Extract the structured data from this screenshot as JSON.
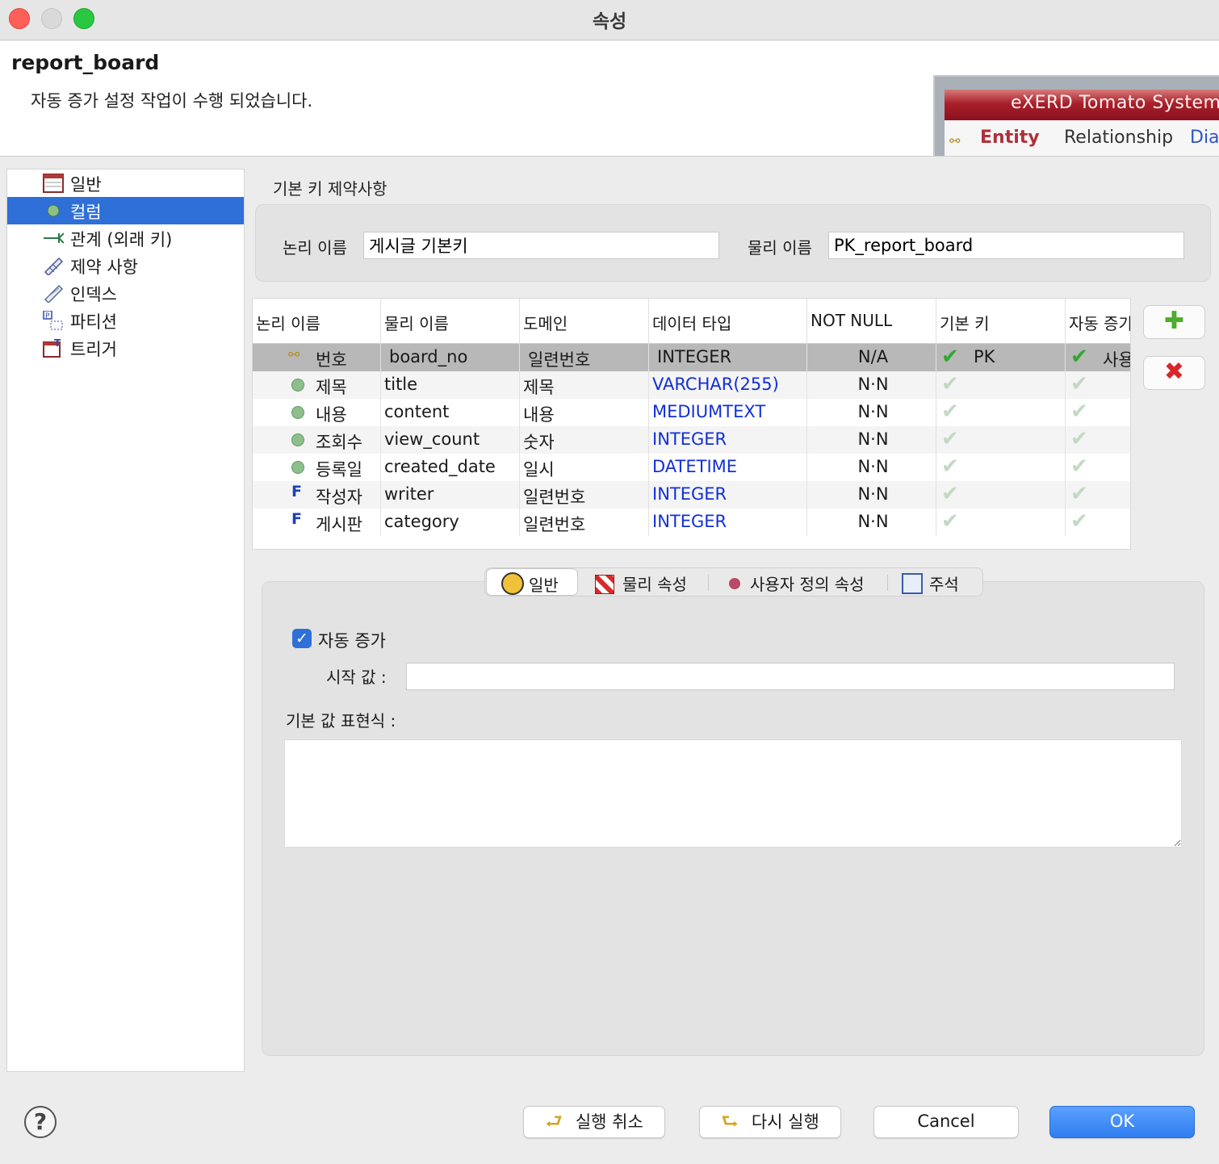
{
  "window": {
    "title": "속성"
  },
  "header": {
    "entity_name": "report_board",
    "message": "자동 증가 설정 작업이 수행 되었습니다.",
    "banner": {
      "app_title": "eXERD  Tomato System",
      "menu": [
        "Entity",
        "Relationship",
        "Dia"
      ]
    }
  },
  "sidebar": {
    "items": [
      {
        "label": "일반",
        "icon": "table-icon"
      },
      {
        "label": "컬럼",
        "icon": "column-icon"
      },
      {
        "label": "관계 (외래 키)",
        "icon": "relationship-icon"
      },
      {
        "label": "제약 사항",
        "icon": "constraint-icon"
      },
      {
        "label": "인덱스",
        "icon": "index-icon"
      },
      {
        "label": "파티션",
        "icon": "partition-icon"
      },
      {
        "label": "트리거",
        "icon": "trigger-icon"
      }
    ],
    "selected": "컬럼"
  },
  "pk": {
    "section_title": "기본 키 제약사항",
    "logical_label": "논리 이름",
    "logical_value": "게시글 기본키",
    "physical_label": "물리 이름",
    "physical_value": "PK_report_board"
  },
  "grid": {
    "headers": [
      "논리 이름",
      "물리 이름",
      "도메인",
      "데이터 타입",
      "NOT NULL",
      "기본 키",
      "자동 증가"
    ],
    "rows": [
      {
        "logical": "번호",
        "physical": "board_no",
        "domain": "일련번호",
        "type": "INTEGER",
        "notnull": "N/A",
        "pk": "PK",
        "auto": "사용",
        "kind": "key"
      },
      {
        "logical": "제목",
        "physical": "title",
        "domain": "제목",
        "type": "VARCHAR(255)",
        "notnull": "N·N",
        "pk": "",
        "auto": "",
        "kind": "attr"
      },
      {
        "logical": "내용",
        "physical": "content",
        "domain": "내용",
        "type": "MEDIUMTEXT",
        "notnull": "N·N",
        "pk": "",
        "auto": "",
        "kind": "attr"
      },
      {
        "logical": "조회수",
        "physical": "view_count",
        "domain": "숫자",
        "type": "INTEGER",
        "notnull": "N·N",
        "pk": "",
        "auto": "",
        "kind": "attr"
      },
      {
        "logical": "등록일",
        "physical": "created_date",
        "domain": "일시",
        "type": "DATETIME",
        "notnull": "N·N",
        "pk": "",
        "auto": "",
        "kind": "attr"
      },
      {
        "logical": "작성자",
        "physical": "writer",
        "domain": "일련번호",
        "type": "INTEGER",
        "notnull": "N·N",
        "pk": "",
        "auto": "",
        "kind": "fk"
      },
      {
        "logical": "게시판",
        "physical": "category",
        "domain": "일련번호",
        "type": "INTEGER",
        "notnull": "N·N",
        "pk": "",
        "auto": "",
        "kind": "fk"
      }
    ],
    "add_icon": "plus-icon",
    "delete_icon": "delete-icon"
  },
  "tabs": [
    "일반",
    "물리 속성",
    "사용자 정의 속성",
    "주석"
  ],
  "detail": {
    "auto_increment_label": "자동 증가",
    "auto_increment_checked": true,
    "start_value_label": "시작 값 :",
    "start_value": "",
    "default_expr_label": "기본 값 표현식 :",
    "default_expr": ""
  },
  "buttons": {
    "undo": "실행 취소",
    "redo": "다시 실행",
    "cancel": "Cancel",
    "ok": "OK",
    "help": "?"
  },
  "colors": {
    "selection": "#2f6fd8",
    "type_text": "#1230d6",
    "ok_button": "#2f7df0"
  }
}
